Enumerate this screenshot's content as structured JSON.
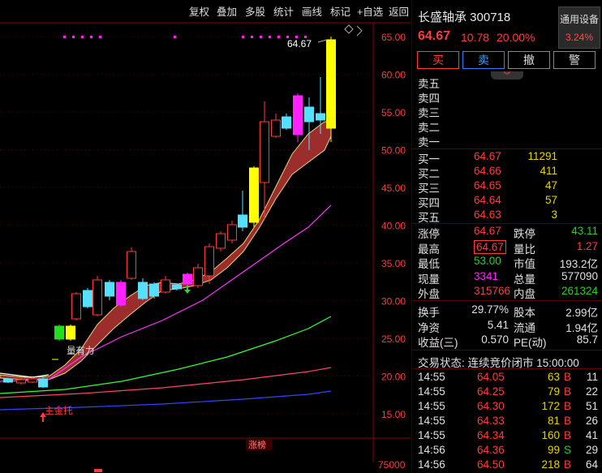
{
  "toolbar": [
    "复权",
    "叠加",
    "多股",
    "统计",
    "画线",
    "标记",
    "+自选",
    "返回"
  ],
  "chart": {
    "y_ticks": [
      "65.00",
      "60.00",
      "55.00",
      "50.00",
      "45.00",
      "40.00",
      "35.00",
      "30.00",
      "25.00",
      "20.00",
      "15.00"
    ],
    "volume_tick": "75000",
    "price_label": "64.67",
    "annotation_1": "量有力",
    "annotation_2": "主金托",
    "bottom_tag": "涨榜"
  },
  "stock": {
    "name_code": "长盛轴承 300718",
    "price": "64.67",
    "change": "10.78",
    "pct": "20.00%"
  },
  "device": {
    "label": "通用设备",
    "pct": "3.24%"
  },
  "actions": [
    "买",
    "卖",
    "撤",
    "警"
  ],
  "sells": [
    "卖五",
    "卖四",
    "卖三",
    "卖二",
    "卖一"
  ],
  "buys": [
    {
      "label": "买一",
      "price": "64.67",
      "vol": "11291"
    },
    {
      "label": "买二",
      "price": "64.66",
      "vol": "411"
    },
    {
      "label": "买三",
      "price": "64.65",
      "vol": "47"
    },
    {
      "label": "买四",
      "price": "64.64",
      "vol": "57"
    },
    {
      "label": "买五",
      "price": "64.63",
      "vol": "3"
    }
  ],
  "stats": [
    {
      "k1": "涨停",
      "v1": "64.67",
      "k2": "跌停",
      "v2": "43.11"
    },
    {
      "k1": "最高",
      "v1": "64.67",
      "k2": "量比",
      "v2": "1.27"
    },
    {
      "k1": "最低",
      "v1": "53.00",
      "k2": "市值",
      "v2": "193.2亿"
    },
    {
      "k1": "现量",
      "v1": "3341",
      "k2": "总量",
      "v2": "577090"
    },
    {
      "k1": "外盘",
      "v1": "315766",
      "k2": "内盘",
      "v2": "261324"
    }
  ],
  "fin": [
    {
      "k1": "换手",
      "v1": "29.77%",
      "k2": "股本",
      "v2": "2.99亿"
    },
    {
      "k1": "净资",
      "v1": "5.41",
      "k2": "流通",
      "v2": "1.94亿"
    },
    {
      "k1": "收益(三)",
      "v1": "0.570",
      "k2": "PE(动)",
      "v2": "85.7"
    }
  ],
  "trade_status": "交易状态: 连续竞价闭市 15:00:00",
  "ticks": [
    {
      "t": "14:55",
      "p": "64.05",
      "v": "63",
      "s": "B",
      "n": "11"
    },
    {
      "t": "14:55",
      "p": "64.25",
      "v": "79",
      "s": "B",
      "n": "22"
    },
    {
      "t": "14:55",
      "p": "64.30",
      "v": "172",
      "s": "B",
      "n": "51"
    },
    {
      "t": "14:55",
      "p": "64.33",
      "v": "81",
      "s": "B",
      "n": "26"
    },
    {
      "t": "14:55",
      "p": "64.34",
      "v": "160",
      "s": "B",
      "n": "41"
    },
    {
      "t": "14:56",
      "p": "64.36",
      "v": "99",
      "s": "S",
      "n": "29"
    },
    {
      "t": "14:56",
      "p": "64.50",
      "v": "218",
      "s": "B",
      "n": "64"
    }
  ]
}
